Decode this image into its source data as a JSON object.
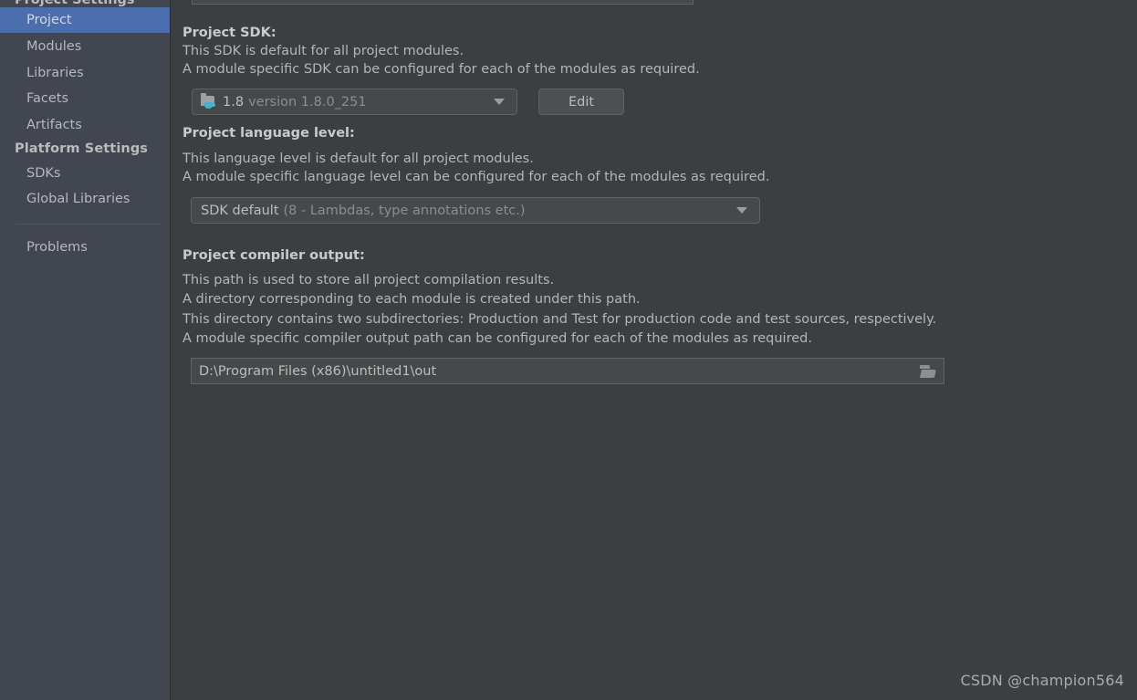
{
  "sidebar": {
    "clipped_header": "Project Settings",
    "project_settings_items": [
      {
        "label": "Project",
        "selected": true
      },
      {
        "label": "Modules",
        "selected": false
      },
      {
        "label": "Libraries",
        "selected": false
      },
      {
        "label": "Facets",
        "selected": false
      },
      {
        "label": "Artifacts",
        "selected": false
      }
    ],
    "platform_settings_title": "Platform Settings",
    "platform_settings_items": [
      {
        "label": "SDKs",
        "selected": false
      },
      {
        "label": "Global Libraries",
        "selected": false
      }
    ],
    "other_items": [
      {
        "label": "Problems",
        "selected": false
      }
    ]
  },
  "main": {
    "project_sdk": {
      "title": "Project SDK:",
      "description_line1": "This SDK is default for all project modules.",
      "description_line2": "A module specific SDK can be configured for each of the modules as required.",
      "combo_value": "1.8",
      "combo_value_detail": "version 1.8.0_251",
      "icon": "java-sdk-icon",
      "edit_button": "Edit"
    },
    "language_level": {
      "title": "Project language level:",
      "description_line1": "This language level is default for all project modules.",
      "description_line2": "A module specific language level can be configured for each of the modules as required.",
      "combo_value": "SDK default",
      "combo_value_detail": "(8 - Lambdas, type annotations etc.)"
    },
    "compiler_output": {
      "title": "Project compiler output:",
      "description_line1": "This path is used to store all project compilation results.",
      "description_line2": "A directory corresponding to each module is created under this path.",
      "description_line3": "This directory contains two subdirectories: Production and Test for production code and test sources, respectively.",
      "description_line4": "A module specific compiler output path can be configured for each of the modules as required.",
      "path_value": "D:\\Program Files (x86)\\untitled1\\out",
      "browse_icon": "folder-browse-icon"
    }
  },
  "watermark": "CSDN @champion564",
  "colors": {
    "sidebar_bg": "#414650",
    "main_bg": "#3c3f41",
    "selection_blue": "#4b6eaf",
    "field_bg": "#45494a",
    "field_border": "#5e6364",
    "text_primary": "#b5b5b5",
    "text_bold": "#cacaca",
    "text_muted": "#8b8d8f",
    "java_cup": "#3cb4d6"
  }
}
